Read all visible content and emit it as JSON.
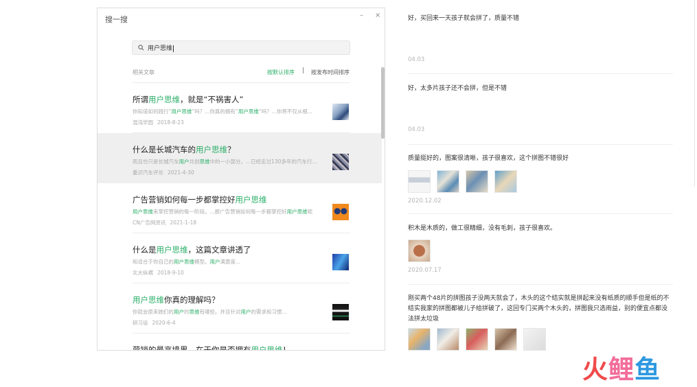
{
  "window": {
    "title": "搜一搜",
    "min_glyph": "–",
    "close_glyph": "×"
  },
  "search": {
    "value": "用户思维"
  },
  "results_header": {
    "label": "相关文章",
    "sort_default": "按默认排序",
    "separator": "|",
    "sort_time": "按发布时间排序"
  },
  "results": [
    {
      "title_pre": "所谓",
      "title_hl": "用户思维",
      "title_post": "，就是“不祸害人”",
      "snippet_parts": [
        {
          "t": "你知道如何践行“",
          "hl": false
        },
        {
          "t": "用户思维",
          "hl": true
        },
        {
          "t": "”吗？...你真的拥有“",
          "hl": false
        },
        {
          "t": "用户思维",
          "hl": true
        },
        {
          "t": "”吗？...你将不仅从根...",
          "hl": false
        }
      ],
      "source": "混沌学园",
      "date": "2018-8-23"
    },
    {
      "title_pre": "什么是长城汽车的",
      "title_hl": "用户思维",
      "title_post": "？",
      "snippet_parts": [
        {
          "t": "而且也只是长城汽车",
          "hl": false
        },
        {
          "t": "用户",
          "hl": true
        },
        {
          "t": "共创",
          "hl": false
        },
        {
          "t": "思维",
          "hl": true
        },
        {
          "t": "中的一小部分。...已经走过130多年的汽车行...",
          "hl": false
        }
      ],
      "source": "重识汽车评论",
      "date": "2021-4-30"
    },
    {
      "title_pre": "广告营销如何每一步都掌控好",
      "title_hl": "用户思维",
      "title_post": "",
      "snippet_parts": [
        {
          "t": "用户思维",
          "hl": true
        },
        {
          "t": "来掌控营销的每一阶段。...那广告营销如何每一步都掌控好",
          "hl": false
        },
        {
          "t": "用户思维",
          "hl": true
        },
        {
          "t": "呢",
          "hl": false
        }
      ],
      "source": "CN广告网资讯",
      "date": "2021-1-18"
    },
    {
      "title_pre": "什么是",
      "title_hl": "用户思维",
      "title_post": "，这篇文章讲透了",
      "snippet_parts": [
        {
          "t": "和适合于你自己的",
          "hl": false
        },
        {
          "t": "用户思维",
          "hl": true
        },
        {
          "t": "模型。",
          "hl": false
        },
        {
          "t": "用户",
          "hl": true
        },
        {
          "t": "满意度...",
          "hl": false
        }
      ],
      "source": "北大纵横",
      "date": "2018-9-10"
    },
    {
      "title_pre": "",
      "title_hl": "用户思维",
      "title_post": "你真的理解吗？",
      "snippet_parts": [
        {
          "t": "你就会原来她们的",
          "hl": false
        },
        {
          "t": "用户",
          "hl": true
        },
        {
          "t": "的",
          "hl": false
        },
        {
          "t": "思维",
          "hl": true
        },
        {
          "t": "有哪些。并且针对",
          "hl": false
        },
        {
          "t": "用户",
          "hl": true
        },
        {
          "t": "的需求和习惯...",
          "hl": false
        }
      ],
      "source": "研习设",
      "date": "2020-6-4"
    },
    {
      "title_pre": "营销的最高境界，在于你是否拥有",
      "title_hl": "用户思维",
      "title_post": "！",
      "snippet_parts": [],
      "source": "",
      "date": ""
    }
  ],
  "feed": [
    {
      "text": "好，买回来一天孩子就会拼了，质量不错",
      "date": "04.03",
      "photo_count": 0
    },
    {
      "text": "好，太多片孩子还不会拼，但是不错",
      "date": "04.03",
      "photo_count": 0
    },
    {
      "text": "质量挺好的，图案很清晰，孩子很喜欢，这个拼图不错很好",
      "date": "2020.12.02",
      "photo_count": 4
    },
    {
      "text": "积木是木质的，做工很精细，没有毛刺，孩子很喜欢。",
      "date": "2020.07.17",
      "photo_count": 1
    },
    {
      "text": "刚买两个48片的拼图孩子没两天就会了，木头的这个结实就是拼起来没有纸质的顺手但是纸的不结实我家的拼图都被儿子给拼破了，这回专门买两个木头的，拼图我只选雨益，别的便宜点都没法拼太垃圾",
      "date": "",
      "photo_count": 5
    }
  ],
  "watermark": {
    "c1": "火",
    "c2": "鲤",
    "c3": "鱼"
  },
  "colors": {
    "accent": "#2aae67",
    "text": "#333333",
    "muted": "#aaaaaa"
  }
}
